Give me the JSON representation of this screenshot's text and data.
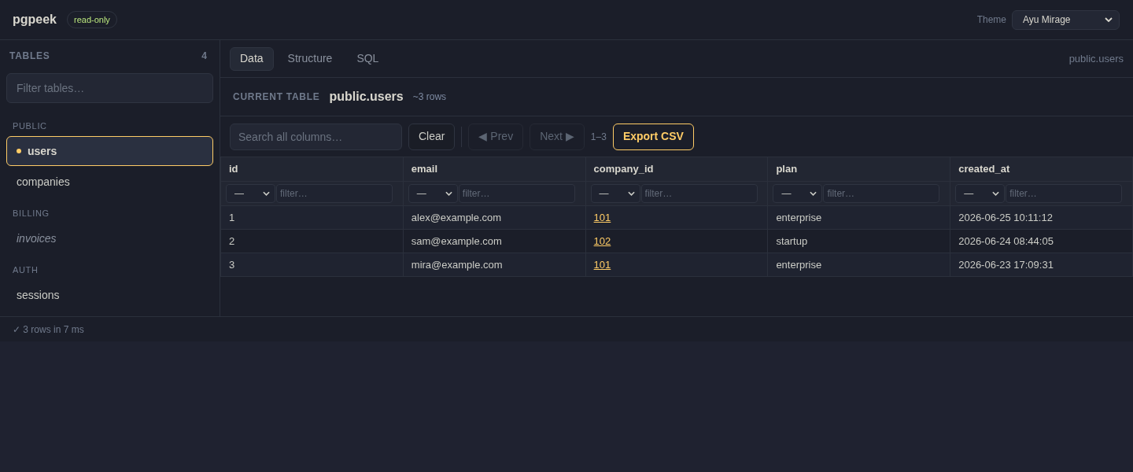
{
  "header": {
    "title": "pgpeek",
    "badge": "read-only",
    "theme": {
      "label": "Theme",
      "value": "Ayu Mirage"
    }
  },
  "sidebar": {
    "heading": "TABLES",
    "count": "4",
    "filter": {
      "placeholder": "Filter tables…"
    },
    "groups": [
      {
        "name": "PUBLIC",
        "items": [
          {
            "label": "users",
            "selected": true,
            "italic": false
          },
          {
            "label": "companies",
            "selected": false,
            "italic": false
          }
        ]
      },
      {
        "name": "BILLING",
        "items": [
          {
            "label": "invoices",
            "selected": false,
            "italic": true
          }
        ]
      },
      {
        "name": "AUTH",
        "items": [
          {
            "label": "sessions",
            "selected": false,
            "italic": false
          }
        ]
      }
    ]
  },
  "tabs": [
    {
      "label": "Data",
      "selected": true
    },
    {
      "label": "Structure",
      "selected": false
    },
    {
      "label": "SQL",
      "selected": false
    }
  ],
  "breadcrumb": "public.users",
  "current_table": {
    "label": "CURRENT TABLE",
    "name": "public.users",
    "row_estimate": "~3 rows"
  },
  "toolbar": {
    "search": {
      "placeholder": "Search all columns…"
    },
    "items": [
      {
        "kind": "button",
        "label": "Clear",
        "disabled": false
      },
      {
        "kind": "separator"
      },
      {
        "kind": "button",
        "label": "◀ Prev",
        "disabled": true
      },
      {
        "kind": "button",
        "label": "Next ▶",
        "disabled": true
      },
      {
        "kind": "range",
        "label": "1–3"
      },
      {
        "kind": "primary",
        "label": "Export CSV",
        "disabled": false
      }
    ]
  },
  "table": {
    "columns": [
      {
        "name": "id",
        "kind": "text",
        "filter": {
          "operator": "—",
          "placeholder": "filter…"
        }
      },
      {
        "name": "email",
        "kind": "text",
        "filter": {
          "operator": "—",
          "placeholder": "filter…"
        }
      },
      {
        "name": "company_id",
        "kind": "link",
        "filter": {
          "operator": "—",
          "placeholder": "filter…"
        }
      },
      {
        "name": "plan",
        "kind": "text",
        "filter": {
          "operator": "—",
          "placeholder": "filter…"
        }
      },
      {
        "name": "created_at",
        "kind": "text",
        "filter": {
          "operator": "—",
          "placeholder": "filter…"
        }
      }
    ],
    "rows": [
      [
        "1",
        "alex@example.com",
        "101",
        "enterprise",
        "2026-06-25 10:11:12"
      ],
      [
        "2",
        "sam@example.com",
        "102",
        "startup",
        "2026-06-24 08:44:05"
      ],
      [
        "3",
        "mira@example.com",
        "101",
        "enterprise",
        "2026-06-23 17:09:31"
      ]
    ]
  },
  "status_bar": {
    "text": "✓ 3 rows in 7 ms"
  }
}
